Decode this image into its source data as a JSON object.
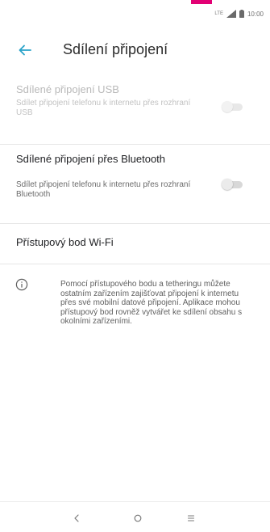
{
  "status_bar": {
    "signal_label": "LTE",
    "time": "10:00"
  },
  "header": {
    "title": "Sdílení připojení"
  },
  "settings": {
    "usb": {
      "title": "Sdílené připojení USB",
      "summary": "Sdílet připojení telefonu k internetu přes rozhraní USB",
      "enabled": false,
      "checked": false
    },
    "bluetooth": {
      "title": "Sdílené připojení přes Bluetooth",
      "summary": "Sdílet připojení telefonu k internetu přes rozhraní Bluetooth",
      "enabled": true,
      "checked": false
    },
    "wifi_hotspot": {
      "title": "Přístupový bod Wi-Fi"
    }
  },
  "info": {
    "text": "Pomocí přístupového bodu a tetheringu můžete ostatním zařízením zajišťovat připojení k internetu přes své mobilní datové připojení. Aplikace mohou přístupový bod rovněž vytvářet ke sdílení obsahu s okolními zařízeními."
  },
  "icons": {
    "back": "arrow-left-icon",
    "info": "info-circle-icon",
    "nav_back": "chevron-left-icon",
    "nav_home": "circle-icon",
    "nav_recents": "menu-lines-icon"
  },
  "colors": {
    "accent": "#2aa3c9",
    "brand": "#e20074",
    "text_primary": "#202124",
    "text_secondary": "#6b6b6b",
    "text_disabled": "#b9b9b9"
  }
}
